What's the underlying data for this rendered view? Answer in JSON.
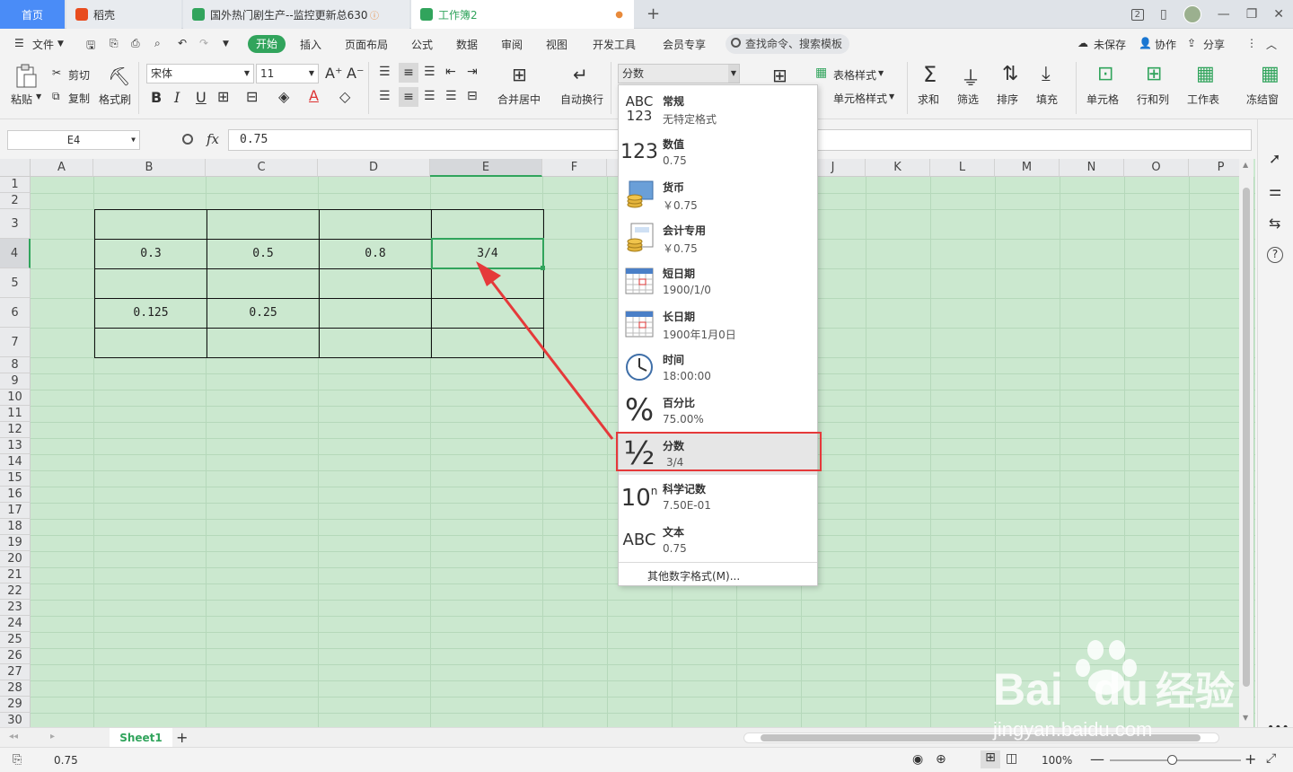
{
  "tabs": {
    "home": "首页",
    "t1": "稻壳",
    "t2": "国外热门剧生产--监控更新总630",
    "t3": "工作簿2",
    "window_badge": "2"
  },
  "menu": {
    "file": "文件",
    "start": "开始",
    "items": [
      "插入",
      "页面布局",
      "公式",
      "数据",
      "审阅",
      "视图",
      "开发工具",
      "会员专享"
    ],
    "search": "查找命令、搜索模板",
    "unsaved": "未保存",
    "collab": "协作",
    "share": "分享"
  },
  "ribbon": {
    "paste": "粘贴",
    "cut": "剪切",
    "copy": "复制",
    "format_painter": "格式刷",
    "font_name": "宋体",
    "font_size": "11",
    "merge_center": "合并居中",
    "wrap_text": "自动换行",
    "number_format": "分数",
    "table_style": "表格样式",
    "cell_style": "单元格样式",
    "sum": "求和",
    "filter": "筛选",
    "sort": "排序",
    "fill": "填充",
    "cell": "单元格",
    "row_col": "行和列",
    "worksheet": "工作表",
    "freeze": "冻结窗"
  },
  "formula_bar": {
    "cell_ref": "E4",
    "fx": "fx",
    "value": "0.75"
  },
  "grid": {
    "columns": [
      "A",
      "B",
      "C",
      "D",
      "E",
      "F",
      "G",
      "H",
      "I",
      "J",
      "K",
      "L",
      "M",
      "N",
      "O",
      "P"
    ],
    "rows": [
      "1",
      "2",
      "3",
      "4",
      "5",
      "6",
      "7",
      "8",
      "9",
      "10",
      "11",
      "12",
      "13",
      "14",
      "15",
      "16",
      "17",
      "18",
      "19",
      "20",
      "21",
      "22",
      "23",
      "24",
      "25",
      "26",
      "27",
      "28",
      "29",
      "30"
    ],
    "cells": {
      "B4": "0.3",
      "C4": "0.5",
      "D4": "0.8",
      "E4": "3/4",
      "B6": "0.125",
      "C6": "0.25"
    }
  },
  "number_formats": [
    {
      "name": "常规",
      "sample": "无特定格式",
      "icon": "abc-123-icon"
    },
    {
      "name": "数值",
      "sample": "0.75",
      "icon": "number-123-icon"
    },
    {
      "name": "货币",
      "sample": "￥0.75",
      "icon": "currency-coins-icon"
    },
    {
      "name": "会计专用",
      "sample": "￥0.75",
      "icon": "accounting-coins-icon"
    },
    {
      "name": "短日期",
      "sample": "1900/1/0",
      "icon": "calendar-icon"
    },
    {
      "name": "长日期",
      "sample": "1900年1月0日",
      "icon": "calendar-icon"
    },
    {
      "name": "时间",
      "sample": "18:00:00",
      "icon": "clock-icon"
    },
    {
      "name": "百分比",
      "sample": "75.00%",
      "icon": "percent-icon"
    },
    {
      "name": "分数",
      "sample": "3/4",
      "icon": "fraction-icon"
    },
    {
      "name": "科学记数",
      "sample": "7.50E-01",
      "icon": "scientific-icon"
    },
    {
      "name": "文本",
      "sample": "0.75",
      "icon": "abc-text-icon"
    }
  ],
  "icon_glyphs": {
    "abc": "ABC",
    "n123": "123",
    "percent": "%",
    "half": "½",
    "ten": "10",
    "n": "n"
  },
  "more_formats": "其他数字格式(M)...",
  "sheet_tab": "Sheet1",
  "status": {
    "value": "0.75",
    "zoom": "100%"
  },
  "watermark": {
    "brand": "Bai",
    "brand2": "du",
    "cn": "经验",
    "url": "jingyan.baidu.com"
  },
  "colors": {
    "accent": "#31a45c",
    "sheet_bg": "#cbe8cf",
    "highlight_border": "#e5393a",
    "arrow": "#e5393a"
  }
}
